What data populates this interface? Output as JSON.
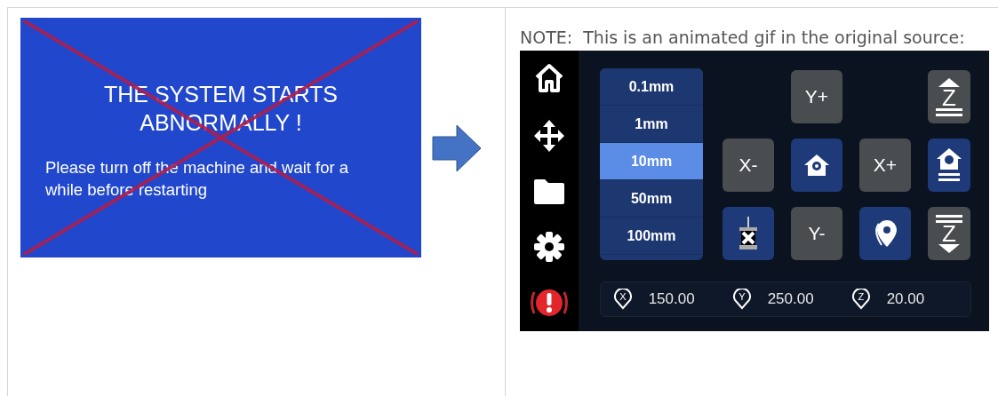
{
  "left_cell": {
    "error_screen": {
      "title": "THE SYSTEM STARTS ABNORMALLY !",
      "message": "Please turn off the machine and wait for a while before restarting"
    }
  },
  "right_cell": {
    "note": "NOTE:  This is an animated gif in the original source:",
    "printer_screen": {
      "step_sizes": [
        {
          "label": "0.1mm",
          "selected": false
        },
        {
          "label": "1mm",
          "selected": false
        },
        {
          "label": "10mm",
          "selected": true
        },
        {
          "label": "50mm",
          "selected": false
        },
        {
          "label": "100mm",
          "selected": false
        }
      ],
      "buttons": [
        {
          "kind": "text",
          "label": "Y+"
        },
        {
          "kind": "z_up",
          "label": "Z"
        },
        {
          "kind": "text",
          "label": "X-"
        },
        {
          "kind": "home"
        },
        {
          "kind": "text",
          "label": "X+"
        },
        {
          "kind": "home_z"
        },
        {
          "kind": "motor_off"
        },
        {
          "kind": "text",
          "label": "Y-"
        },
        {
          "kind": "pin"
        },
        {
          "kind": "z_down",
          "label": "Z"
        }
      ],
      "positions": [
        {
          "axis": "X",
          "value": "150.00"
        },
        {
          "axis": "Y",
          "value": "250.00"
        },
        {
          "axis": "Z",
          "value": "20.00"
        }
      ]
    }
  }
}
